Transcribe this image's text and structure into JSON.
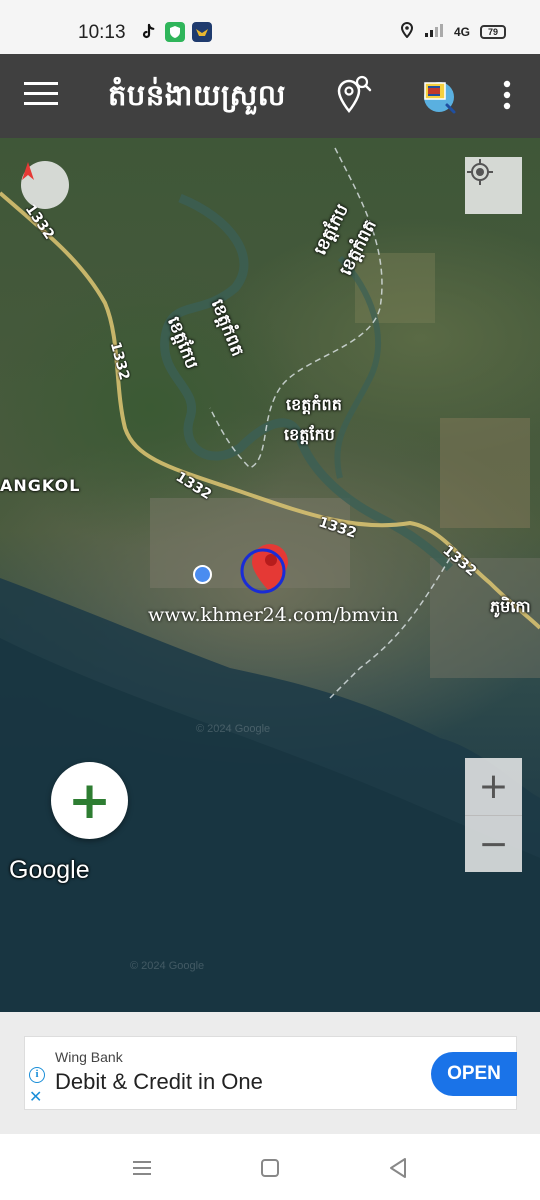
{
  "status_bar": {
    "time": "10:13",
    "network": "4G",
    "battery": "79",
    "icons": [
      "tiktok-icon",
      "shield-icon",
      "bird-app-icon",
      "location-icon",
      "signal-icon",
      "battery-icon"
    ]
  },
  "app_bar": {
    "title": "តំបន់ងាយស្រួល",
    "icons": [
      "menu-icon",
      "map-search-icon",
      "khmer-flag-search-icon",
      "more-vertical-icon"
    ],
    "background": "#404040"
  },
  "map": {
    "place_labels": [
      {
        "text": "ខេត្តកែប"
      },
      {
        "text": "ខេត្តកំពត"
      },
      {
        "text": "ខេត្តកំពត"
      },
      {
        "text": "ខេត្តកែប"
      },
      {
        "text": "ខេត្តកំពត"
      },
      {
        "text": "ខេត្តកែប"
      },
      {
        "text": "ANGKOL"
      },
      {
        "text": "ភូមិកោ"
      }
    ],
    "road_labels": [
      "1332",
      "1332",
      "1332",
      "1332",
      "1332"
    ],
    "watermark": "www.khmer24.com/bmvin",
    "copyright": "© 2024 Google",
    "google_logo": "Google",
    "zoom_in": "+",
    "zoom_out": "−",
    "add_button": "+",
    "compass_label": "N",
    "marker_color": "#e53935",
    "accent_green": "#2e7d32"
  },
  "ad": {
    "brand": "Wing Bank",
    "headline": "Debit & Credit in One",
    "cta": "OPEN",
    "info_icon": "i",
    "close_icon": "✕",
    "cta_color": "#1a73e8"
  },
  "nav_bar": {
    "icons": [
      "recent-apps-icon",
      "home-icon",
      "back-icon"
    ]
  }
}
